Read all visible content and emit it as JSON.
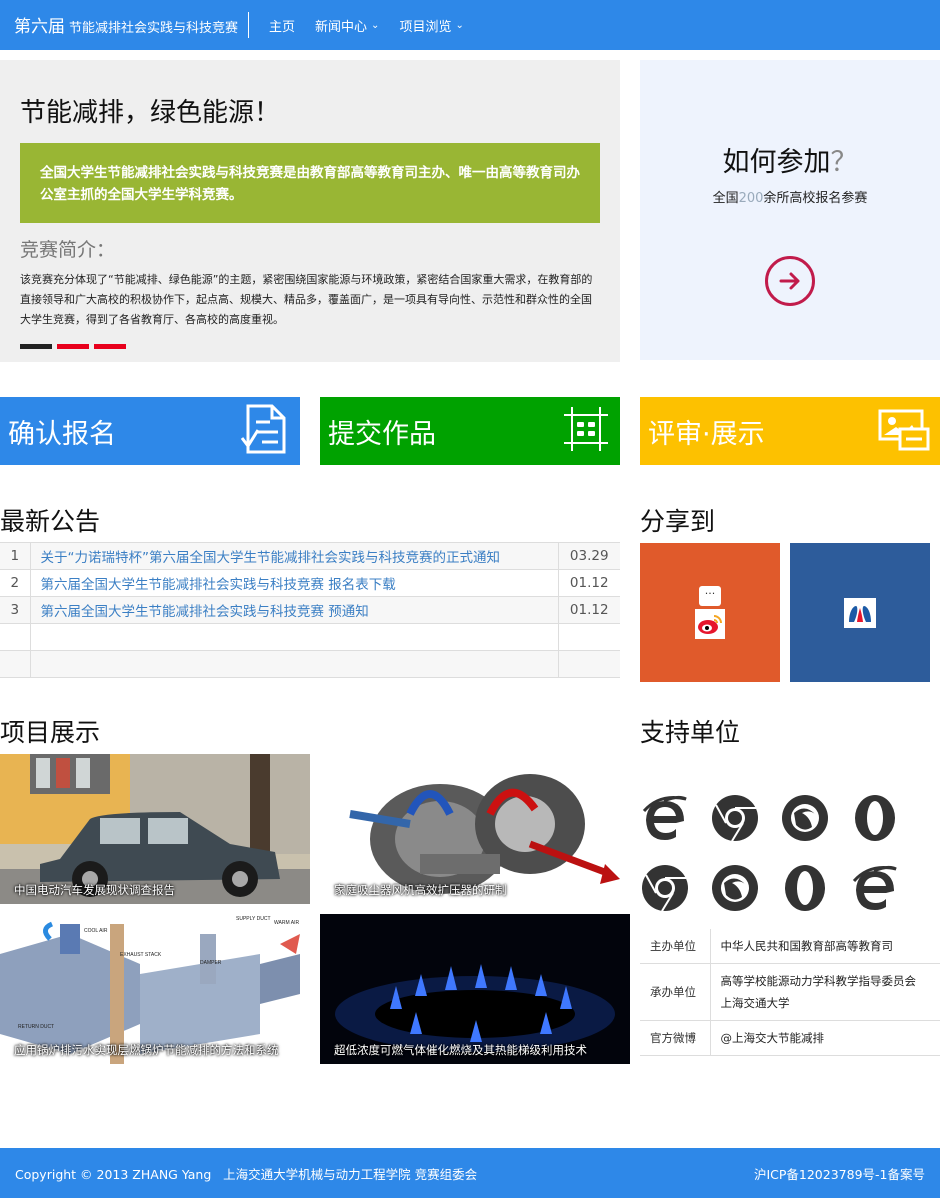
{
  "nav": {
    "brand_edition": "第六届",
    "brand_name": "节能减排社会实践与科技竞赛",
    "items": [
      {
        "label": "主页"
      },
      {
        "label": "新闻中心",
        "caret": "⌄"
      },
      {
        "label": "项目浏览",
        "caret": "⌄"
      }
    ]
  },
  "hero": {
    "title": "节能减排，绿色能源！",
    "banner": "全国大学生节能减排社会实践与科技竞赛是由教育部高等教育司主办、唯一由高等教育司办公室主抓的全国大学生学科竞赛。",
    "subtitle": "竞赛简介：",
    "text": "该竞赛充分体现了“节能减排、绿色能源”的主题，紧密围绕国家能源与环境政策，紧密结合国家重大需求，在教育部的直接领导和广大高校的积极协作下，起点高、规模大、精品多，覆盖面广，是一项具有导向性、示范性和群众性的全国大学生竞赛，得到了各省教育厅、各高校的高度重视。",
    "indicators": [
      "#222222",
      "#e8001c",
      "#e8001c"
    ]
  },
  "join": {
    "title": "如何参加",
    "title_mark": "？",
    "sub_prefix": "全国",
    "sub_number": "200",
    "sub_suffix": "余所高校报名参赛",
    "arrow_icon": "arrow-right-circle-icon",
    "accent": "#c11b4b"
  },
  "tiles": [
    {
      "label": "确认报名",
      "color": "#2e88e8",
      "icon": "form-icon"
    },
    {
      "label": "提交作品",
      "color": "#00a200",
      "icon": "submit-grid-icon"
    },
    {
      "label": "评审·展示",
      "color": "#fdc100",
      "icon": "display-image-icon"
    }
  ],
  "notices": {
    "title": "最新公告",
    "rows": [
      {
        "idx": "1",
        "title": "关于“力诺瑞特杯”第六届全国大学生节能减排社会实践与科技竞赛的正式通知",
        "date": "03.29"
      },
      {
        "idx": "2",
        "title": "第六届全国大学生节能减排社会实践与科技竞赛 报名表下载",
        "date": "01.12"
      },
      {
        "idx": "3",
        "title": "第六届全国大学生节能减排社会实践与科技竞赛 预通知",
        "date": "01.12"
      },
      {
        "idx": "",
        "title": "",
        "date": ""
      },
      {
        "idx": "",
        "title": "",
        "date": ""
      }
    ]
  },
  "share": {
    "title": "分享到",
    "targets": [
      {
        "name": "weibo",
        "color": "#e05a2b",
        "bubble": "..."
      },
      {
        "name": "renren",
        "color": "#2d5c9b"
      }
    ]
  },
  "projects": {
    "title": "项目展示",
    "items": [
      {
        "caption": "中国电动汽车发展现状调查报告"
      },
      {
        "caption": "家庭吸尘器风机高效扩压器的研制"
      },
      {
        "caption": "应用锅炉排污水实现层燃锅炉节能减排的方法和系统"
      },
      {
        "caption": "超低浓度可燃气体催化燃烧及其热能梯级利用技术"
      }
    ]
  },
  "support": {
    "title": "支持单位",
    "icons": [
      "ie-icon",
      "chrome-icon",
      "firefox-icon",
      "opera-icon",
      "chrome-icon",
      "firefox-icon",
      "opera-icon",
      "ie-icon"
    ],
    "rows": [
      {
        "label": "主办单位",
        "value": "中华人民共和国教育部高等教育司"
      },
      {
        "label": "承办单位",
        "value": "高等学校能源动力学科教学指导委员会 上海交通大学"
      },
      {
        "label": "官方微博",
        "value": "@上海交大节能减排"
      }
    ]
  },
  "footer": {
    "left": "Copyright © 2013 ZHANG Yang   上海交通大学机械与动力工程学院 竞赛组委会",
    "right": "沪ICP备12023789号-1备案号"
  }
}
